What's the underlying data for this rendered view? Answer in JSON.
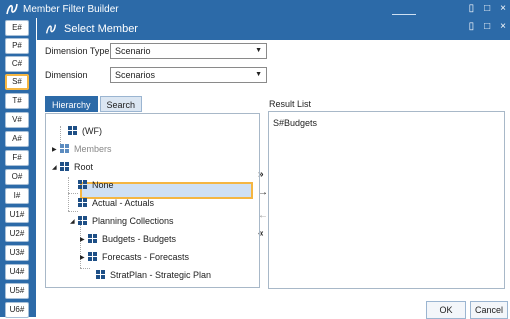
{
  "app": {
    "outer_title": "Member Filter Builder",
    "dialog_title": "Select Member",
    "brand_color": "#2c6aa8",
    "highlight_color": "#f5b642",
    "window_controls": {
      "restore": "▯",
      "maximize": "□",
      "close": "×"
    }
  },
  "left_strip": {
    "buttons": [
      "E#",
      "P#",
      "C#",
      "S#",
      "T#",
      "V#",
      "A#",
      "F#",
      "O#",
      "I#",
      "U1#",
      "U2#",
      "U3#",
      "U4#",
      "U5#",
      "U6#"
    ],
    "active": "S#"
  },
  "form": {
    "dimension_type_label": "Dimension Type",
    "dimension_type_value": "Scenario",
    "dimension_label": "Dimension",
    "dimension_value": "Scenarios"
  },
  "tabs": [
    "Hierarchy",
    "Search"
  ],
  "tree": [
    {
      "label": "(WF)",
      "expander": "none"
    },
    {
      "label": "Members",
      "expander": "collapsed"
    },
    {
      "label": "Root",
      "expander": "expanded"
    },
    {
      "label": "None",
      "expander": "none"
    },
    {
      "label": "Actual - Actuals",
      "expander": "none"
    },
    {
      "label": "Planning Collections",
      "expander": "expanded"
    },
    {
      "label": "Budgets - Budgets",
      "expander": "collapsed",
      "selected": true
    },
    {
      "label": "Forecasts - Forecasts",
      "expander": "collapsed"
    },
    {
      "label": "StratPlan - Strategic Plan",
      "expander": "none"
    }
  ],
  "arrows": {
    "add_all": "»",
    "add": "→",
    "remove": "←",
    "remove_all": "«"
  },
  "result": {
    "label": "Result List",
    "items": [
      "S#Budgets"
    ]
  },
  "footer": {
    "ok": "OK",
    "cancel": "Cancel"
  }
}
